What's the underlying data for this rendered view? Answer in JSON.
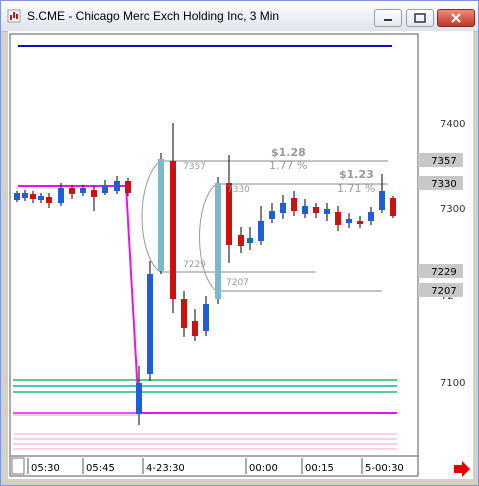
{
  "window": {
    "title": "S.CME - Chicago Merc Exch Holding Inc, 3 Min",
    "icon": "chart-app-icon",
    "controls": [
      "minimize-icon",
      "maximize-icon",
      "close-icon"
    ]
  },
  "price_axis": {
    "ticks": [
      "7400",
      "7300",
      "7100"
    ],
    "price_tags": [
      "7357",
      "7330",
      "7229",
      "7207"
    ],
    "partial_tick": "72"
  },
  "time_axis": {
    "labels": [
      "05:30",
      "05:45",
      "4-23:30",
      "00:00",
      "00:15",
      "5-00:30"
    ]
  },
  "annotations": {
    "move1": {
      "change": "$1.28",
      "percent": "1.77 %",
      "high": "7357",
      "low": "7229"
    },
    "move2": {
      "change": "$1.23",
      "percent": "1.71 %",
      "high": "7330",
      "low": "7207"
    }
  },
  "colors": {
    "up": "#1f5fd6",
    "down": "#cc1111",
    "magenta": "#ee11ee",
    "blue_line": "#1010c0",
    "green": "#22bb66",
    "teal": "#11aabb",
    "pink": "#f4a0c8",
    "scroll_arrow": "#dd0000"
  }
}
